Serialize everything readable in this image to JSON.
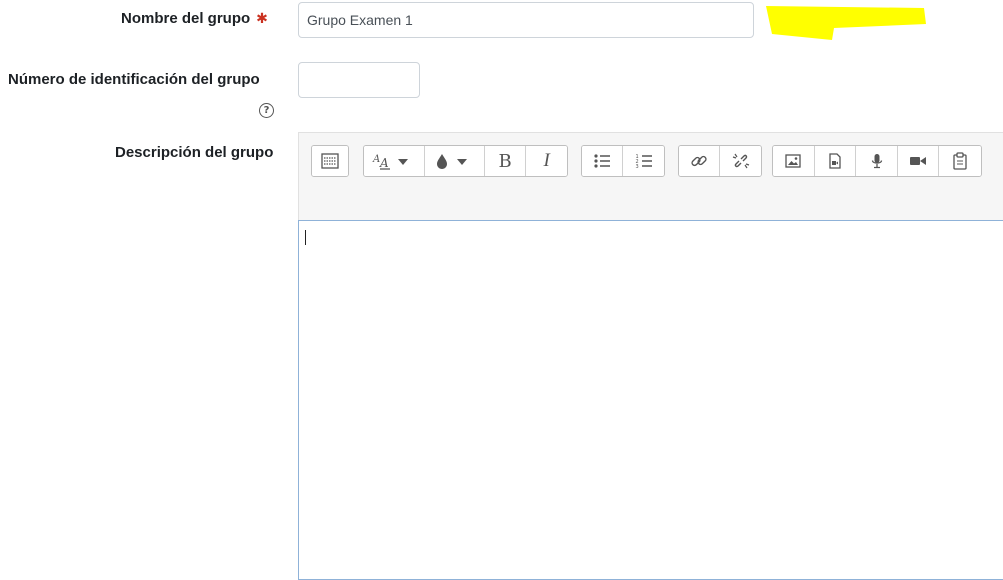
{
  "form": {
    "group_name": {
      "label": "Nombre del grupo",
      "required_mark": "✱",
      "value": "Grupo Examen 1"
    },
    "group_id": {
      "label": "Número de identificación del grupo",
      "value": "",
      "help_icon": "question-circle-icon"
    },
    "group_description": {
      "label": "Descripción del grupo",
      "content": ""
    }
  },
  "toolbar": {
    "groups": [
      [
        "toggle-toolbar-icon"
      ],
      [
        "text-style-icon",
        "font-color-icon",
        "bold-icon",
        "italic-icon"
      ],
      [
        "unordered-list-icon",
        "ordered-list-icon"
      ],
      [
        "link-icon",
        "unlink-icon"
      ],
      [
        "image-icon",
        "media-icon",
        "record-audio-icon",
        "record-video-icon",
        "manage-files-icon"
      ]
    ],
    "bold_glyph": "B",
    "italic_glyph": "I"
  },
  "colors": {
    "required": "#ca3120",
    "input_border": "#ced4da",
    "editor_focus_border": "#8fb2d8",
    "highlight": "#ffff00"
  }
}
